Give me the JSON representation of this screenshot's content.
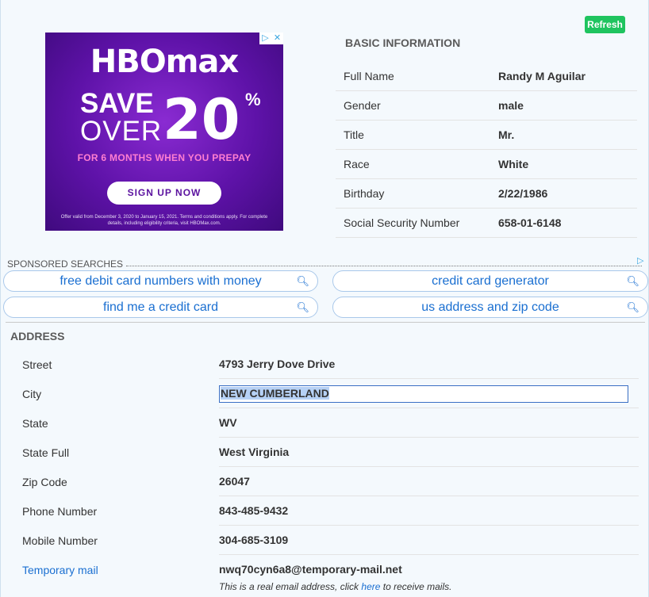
{
  "refresh_label": "Refresh",
  "ad": {
    "logo": "HBOmax",
    "save_line1": "SAVE",
    "save_line2": "OVER",
    "big_number": "20",
    "percent": "%",
    "subline": "FOR 6 MONTHS WHEN YOU PREPAY",
    "cta": "SIGN UP NOW",
    "fine_print": "Offer valid from December 3, 2020 to January 15, 2021. Terms and conditions apply. For complete details, including eligibility criteria, visit HBOMax.com.",
    "badge_info": "▷",
    "badge_close": "✕"
  },
  "basic": {
    "heading": "BASIC INFORMATION",
    "rows": [
      {
        "label": "Full Name",
        "value": "Randy M Aguilar"
      },
      {
        "label": "Gender",
        "value": "male"
      },
      {
        "label": "Title",
        "value": "Mr."
      },
      {
        "label": "Race",
        "value": "White"
      },
      {
        "label": "Birthday",
        "value": "2/22/1986"
      },
      {
        "label": "Social Security Number",
        "value": "658-01-6148"
      }
    ]
  },
  "sponsored": {
    "label": "SPONSORED SEARCHES",
    "adchoice": "▷",
    "searches": [
      "free debit card numbers with money",
      "credit card generator",
      "find me a credit card",
      "us address and zip code"
    ],
    "search_icon": "magnifier-icon"
  },
  "address": {
    "heading": "ADDRESS",
    "rows": [
      {
        "label": "Street",
        "value": "4793  Jerry Dove Drive"
      },
      {
        "label": "City",
        "value": "NEW CUMBERLAND"
      },
      {
        "label": "State",
        "value": "WV"
      },
      {
        "label": "State Full",
        "value": "West Virginia"
      },
      {
        "label": "Zip Code",
        "value": "26047"
      },
      {
        "label": "Phone Number",
        "value": "843-485-9432"
      },
      {
        "label": "Mobile Number",
        "value": "304-685-3109"
      },
      {
        "label": "Temporary mail",
        "value": "nwq70cyn6a8@temporary-mail.net"
      }
    ],
    "mail_note_prefix": "This is a real email address, click ",
    "mail_note_link": "here",
    "mail_note_suffix": " to receive mails."
  },
  "colors": {
    "refresh": "#1fc45f",
    "link": "#1a6fd1",
    "ad_purple": "#5e12a8",
    "ad_pink": "#ff7ed1"
  }
}
